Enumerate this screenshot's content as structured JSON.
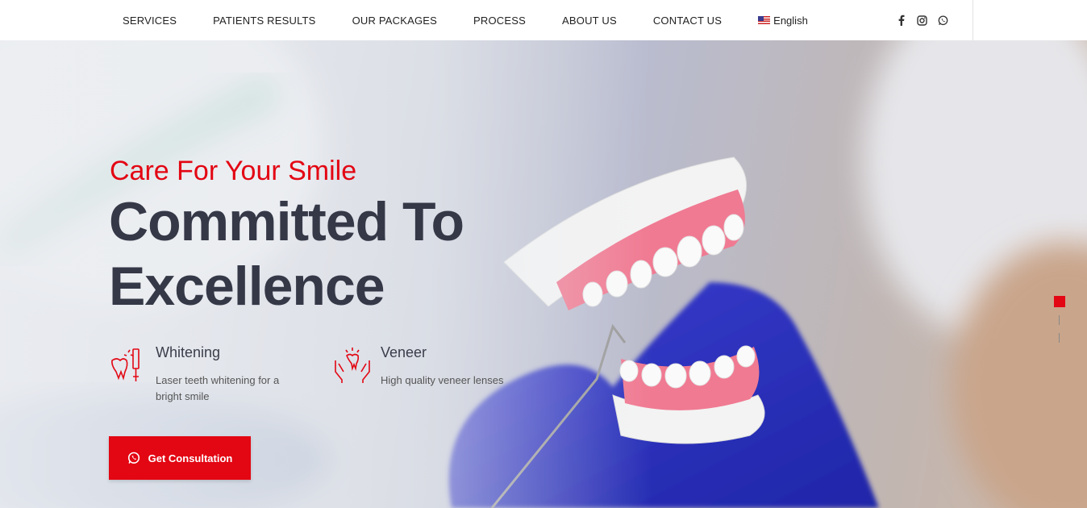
{
  "nav": {
    "items": [
      "SERVICES",
      "PATIENTS RESULTS",
      "OUR PACKAGES",
      "PROCESS",
      "ABOUT US",
      "CONTACT US"
    ],
    "language": "English",
    "socials": [
      "facebook-icon",
      "instagram-icon",
      "whatsapp-icon"
    ]
  },
  "hero": {
    "eyebrow": "Care For Your Smile",
    "headline_line1": "Committed To",
    "headline_line2": "Excellence",
    "features": [
      {
        "icon": "tooth-whitening-icon",
        "title": "Whitening",
        "desc": "Laser teeth whitening for a bright smile"
      },
      {
        "icon": "veneer-hands-icon",
        "title": "Veneer",
        "desc": "High quality veneer lenses"
      }
    ],
    "cta": "Get Consultation"
  },
  "colors": {
    "accent": "#e30613",
    "headline": "#353847"
  }
}
